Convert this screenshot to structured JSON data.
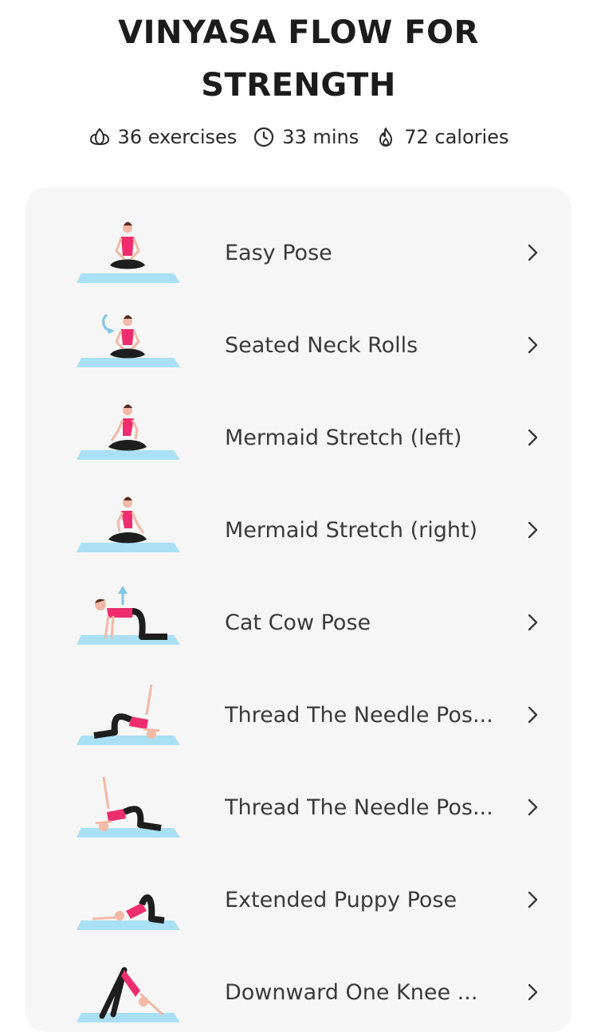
{
  "title_line1": "VINYASA FLOW FOR",
  "title_line2": "STRENGTH",
  "stats": {
    "exercises": "36 exercises",
    "duration": "33 mins",
    "calories": "72 calories"
  },
  "exercises": [
    {
      "name": "Easy Pose",
      "icon": "easy-pose-figure"
    },
    {
      "name": "Seated Neck Rolls",
      "icon": "seated-neck-rolls-figure"
    },
    {
      "name": "Mermaid Stretch (left)",
      "icon": "mermaid-left-figure"
    },
    {
      "name": "Mermaid Stretch (right)",
      "icon": "mermaid-right-figure"
    },
    {
      "name": "Cat Cow Pose",
      "icon": "cat-cow-figure"
    },
    {
      "name": "Thread The Needle Pos...",
      "icon": "thread-needle-figure"
    },
    {
      "name": "Thread The Needle Pos...",
      "icon": "thread-needle-figure"
    },
    {
      "name": "Extended Puppy Pose",
      "icon": "puppy-pose-figure"
    },
    {
      "name": "Downward One Knee ...",
      "icon": "downward-knee-figure"
    }
  ],
  "colors": {
    "mat": "#a9e0f3",
    "shirt": "#ee2d6e",
    "pants": "#1e1e1e",
    "skin": "#f2b9a6",
    "card": "#f6f6f6"
  }
}
